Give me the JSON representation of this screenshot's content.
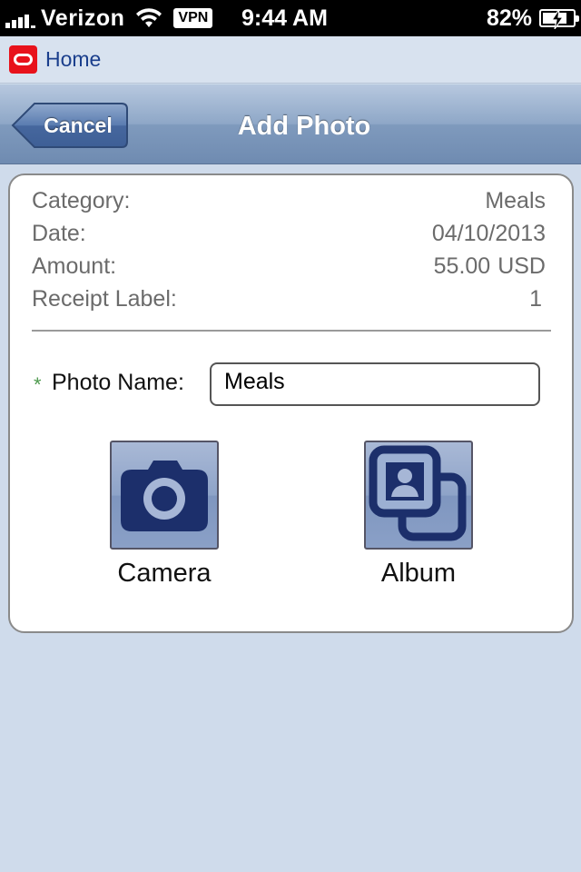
{
  "status_bar": {
    "carrier": "Verizon",
    "vpn": "VPN",
    "time": "9:44 AM",
    "battery": "82%",
    "battery_level": 0.82
  },
  "home_bar": {
    "home_label": "Home"
  },
  "nav": {
    "cancel_label": "Cancel",
    "title": "Add Photo"
  },
  "details": [
    {
      "label": "Category:",
      "value": "Meals"
    },
    {
      "label": "Date:",
      "value": "04/10/2013"
    },
    {
      "label": "Amount:",
      "value": "55.00",
      "currency": "USD"
    },
    {
      "label": "Receipt Label:",
      "value": "1"
    }
  ],
  "photo_name": {
    "required_marker": "*",
    "label": "Photo Name:",
    "value": "Meals"
  },
  "actions": {
    "camera_label": "Camera",
    "album_label": "Album"
  },
  "colors": {
    "background": "#cfdbeb",
    "link": "#1a3e8c",
    "brand_red": "#e8121b",
    "icon_navy": "#1c2f6b"
  }
}
